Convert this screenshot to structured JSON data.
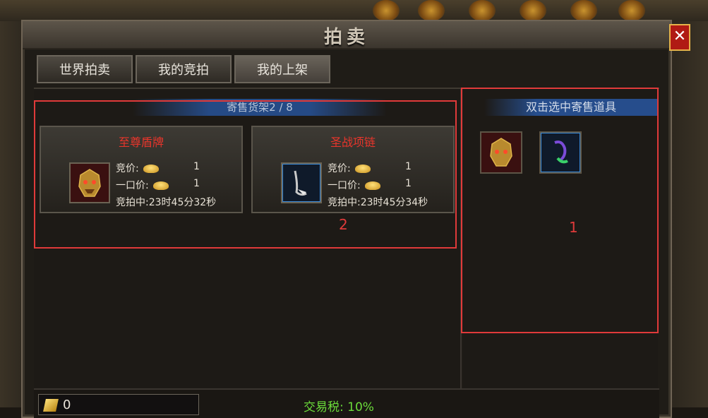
{
  "window": {
    "title": "拍卖",
    "close_label": "✕"
  },
  "tabs": [
    {
      "label": "世界拍卖",
      "active": false
    },
    {
      "label": "我的竞拍",
      "active": false
    },
    {
      "label": "我的上架",
      "active": true
    }
  ],
  "shelf": {
    "header": "寄售货架2 / 8",
    "cards": [
      {
        "name": "至尊盾牌",
        "icon": "dragon-mask-icon",
        "bid_label": "竞价:",
        "bid_value": "1",
        "buyout_label": "一口价:",
        "buyout_value": "1",
        "time_label": "竞拍中:",
        "time_value": "23时45分32秒"
      },
      {
        "name": "圣战项链",
        "icon": "necklace-icon",
        "bid_label": "竞价:",
        "bid_value": "1",
        "buyout_label": "一口价:",
        "buyout_value": "1",
        "time_label": "竞拍中:",
        "time_value": "23时45分34秒"
      }
    ]
  },
  "items_panel": {
    "header": "双击选中寄售道具",
    "items": [
      {
        "icon": "dragon-mask-icon"
      },
      {
        "icon": "necklace-icon"
      }
    ]
  },
  "bottom": {
    "money": "0",
    "tax": "交易税: 10%"
  },
  "annotations": {
    "shelf_number": "2",
    "items_number": "1"
  },
  "colors": {
    "item_name": "#e8352b",
    "annotation": "#e03a3a",
    "tax": "#6bdc3a"
  }
}
